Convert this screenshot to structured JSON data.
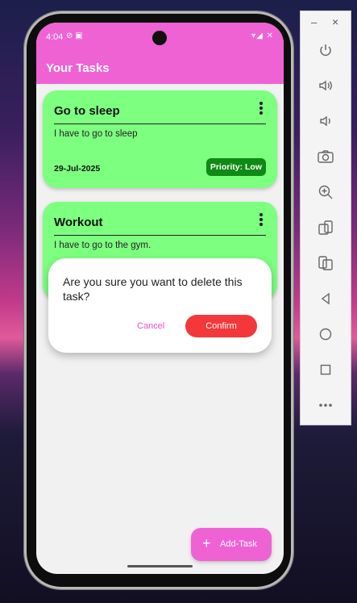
{
  "statusbar": {
    "time": "4:04",
    "left_icons": "⊘ ▣",
    "right_icons": "▾◢ ✕"
  },
  "appbar": {
    "title": "Your Tasks"
  },
  "tasks": [
    {
      "title": "Go to sleep",
      "description": "I have to go to sleep",
      "date": "29-Jul-2025",
      "priority": "Priority: Low"
    },
    {
      "title": "Workout",
      "description": "I have to go to the gym."
    }
  ],
  "dialog": {
    "message": "Are you sure you want to delete this task?",
    "cancel_label": "Cancel",
    "confirm_label": "Confirm"
  },
  "fab": {
    "icon": "+",
    "label": "Add-Task"
  },
  "emulator": {
    "minimize": "–",
    "close": "×",
    "buttons": [
      "power-icon",
      "volume-up-icon",
      "volume-down-icon",
      "camera-icon",
      "zoom-icon",
      "rotate-left-icon",
      "rotate-right-icon",
      "back-icon",
      "home-icon",
      "overview-icon",
      "more-icon"
    ]
  },
  "colors": {
    "app_bar": "#ef62d4",
    "card": "#7dff80",
    "priority_badge": "#0f8a14",
    "confirm": "#f2383a",
    "cancel_text": "#e64fc9"
  }
}
